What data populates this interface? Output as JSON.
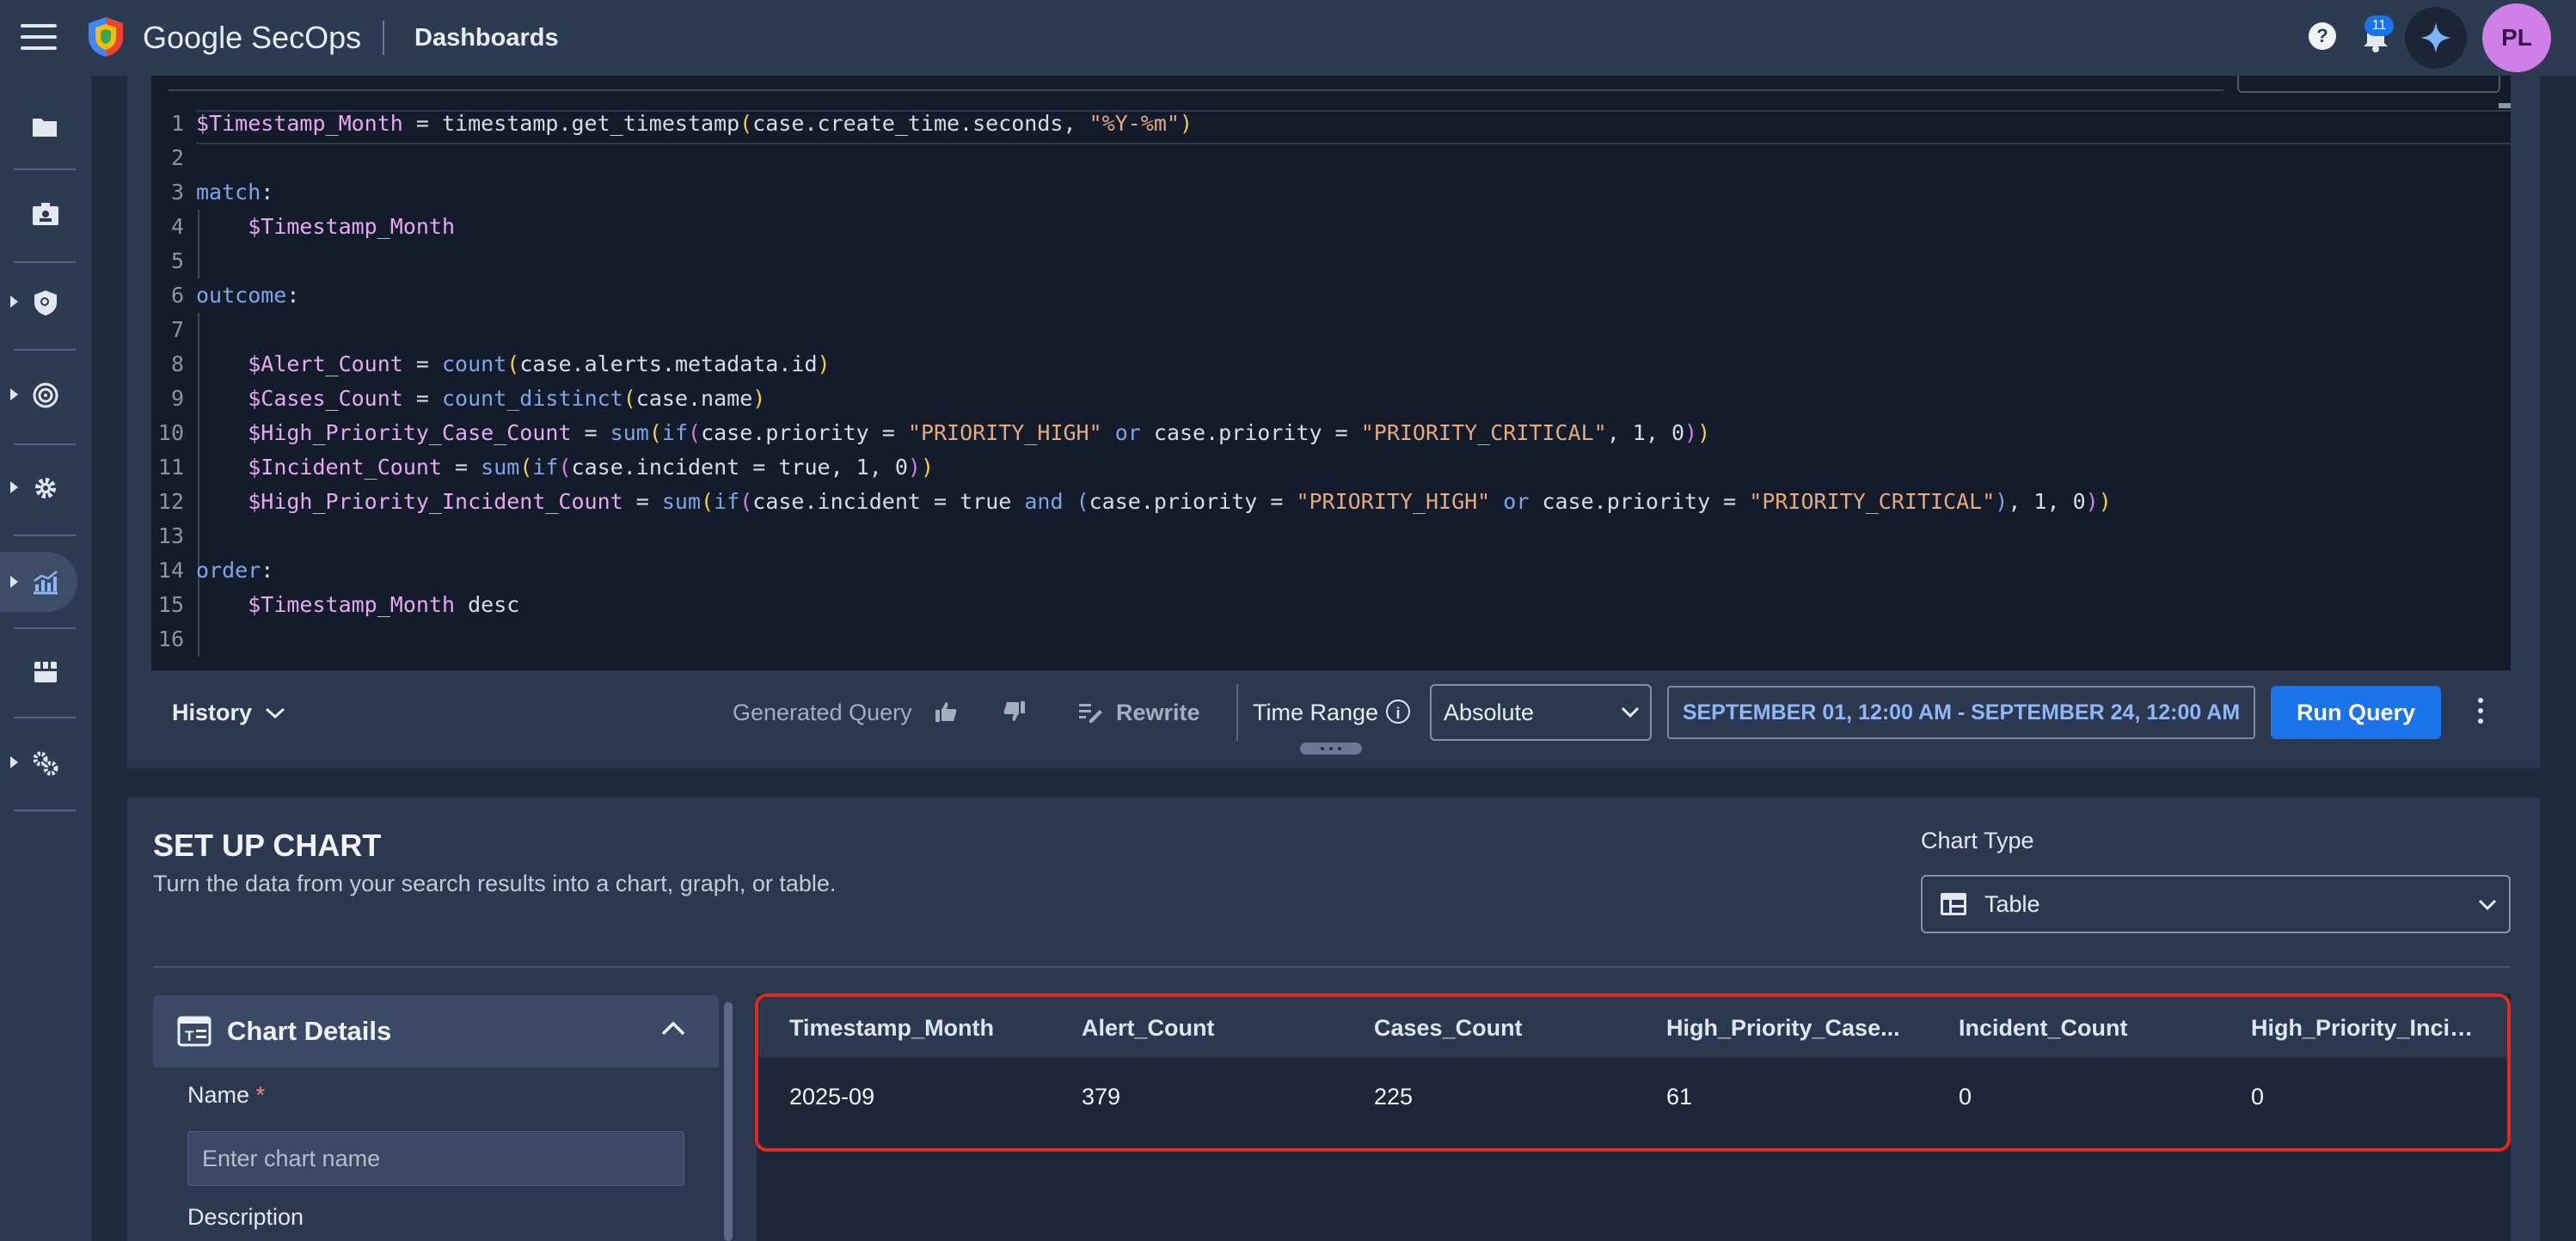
{
  "header": {
    "brand": "Google SecOps",
    "page_title": "Dashboards",
    "notification_count": "11",
    "avatar_initials": "PL",
    "help_glyph": "?"
  },
  "sidebar": {
    "items": [
      {
        "icon": "folder-icon"
      },
      {
        "icon": "cases-icon"
      },
      {
        "icon": "detection-icon",
        "expandable": true
      },
      {
        "icon": "investigation-icon",
        "expandable": true
      },
      {
        "icon": "settings-icon",
        "expandable": true
      },
      {
        "icon": "dashboards-icon",
        "expandable": true,
        "active": true
      },
      {
        "icon": "marketplace-icon"
      },
      {
        "icon": "admin-settings-icon",
        "expandable": true
      }
    ]
  },
  "editor": {
    "line_numbers": [
      "1",
      "2",
      "3",
      "4",
      "5",
      "6",
      "7",
      "8",
      "9",
      "10",
      "11",
      "12",
      "13",
      "14",
      "15",
      "16"
    ],
    "line1": {
      "var": "$Timestamp_Month",
      "op": " = ",
      "fn": "timestamp.get_timestamp",
      "open": "(",
      "arg": "case.create_time.seconds, ",
      "str": "\"%Y-%m\"",
      "close": ")"
    },
    "line3": {
      "kw": "match",
      "colon": ":"
    },
    "line4": {
      "var": "$Timestamp_Month"
    },
    "line6": {
      "kw": "outcome",
      "colon": ":"
    },
    "line8": {
      "var": "$Alert_Count",
      "op": " = ",
      "fn": "count",
      "open": "(",
      "arg": "case.alerts.metadata.id",
      "close": ")"
    },
    "line9": {
      "var": "$Cases_Count",
      "op": " = ",
      "fn": "count_distinct",
      "open": "(",
      "arg": "case.name",
      "close": ")"
    },
    "line10": {
      "var": "$High_Priority_Case_Count",
      "op": " = ",
      "fn1": "sum",
      "open1": "(",
      "fn2": "if",
      "open2": "(",
      "a1": "case.priority = ",
      "s1": "\"PRIORITY_HIGH\"",
      "or": " or ",
      "a2": "case.priority = ",
      "s2": "\"PRIORITY_CRITICAL\"",
      "a3": ", 1, 0",
      "close2": ")",
      "close1": ")"
    },
    "line11": {
      "var": "$Incident_Count",
      "op": " = ",
      "fn1": "sum",
      "open1": "(",
      "fn2": "if",
      "open2": "(",
      "a1": "case.incident = true, 1, 0",
      "close2": ")",
      "close1": ")"
    },
    "line12": {
      "var": "$High_Priority_Incident_Count",
      "op": " = ",
      "fn1": "sum",
      "open1": "(",
      "fn2": "if",
      "open2": "(",
      "a1": "case.incident = true ",
      "and": "and",
      "sp": " ",
      "open3": "(",
      "a2": "case.priority = ",
      "s1": "\"PRIORITY_HIGH\"",
      "or": " or ",
      "a3": "case.priority = ",
      "s2": "\"PRIORITY_CRITICAL\"",
      "close3": ")",
      "a4": ", 1, 0",
      "close2": ")",
      "close1": ")"
    },
    "line14": {
      "kw": "order",
      "colon": ":"
    },
    "line15": {
      "var": "$Timestamp_Month",
      "rest": " desc"
    }
  },
  "toolbar": {
    "history_label": "History",
    "generated_query_label": "Generated Query",
    "rewrite_label": "Rewrite",
    "time_range_label": "Time Range",
    "time_mode": "Absolute",
    "date_range": "SEPTEMBER 01, 12:00 AM - SEPTEMBER 24, 12:00 AM",
    "run_label": "Run Query"
  },
  "setup": {
    "title": "SET UP CHART",
    "subtitle": "Turn the data from your search results into a chart, graph, or table.",
    "chart_type_label": "Chart Type",
    "chart_type_value": "Table"
  },
  "details": {
    "title": "Chart Details",
    "name_label": "Name",
    "required_mark": "*",
    "name_placeholder": "Enter chart name",
    "name_value": "",
    "description_label": "Description"
  },
  "results": {
    "columns": [
      "Timestamp_Month",
      "Alert_Count",
      "Cases_Count",
      "High_Priority_Case...",
      "Incident_Count",
      "High_Priority_Incid..."
    ],
    "rows": [
      [
        "2025-09",
        "379",
        "225",
        "61",
        "0",
        "0"
      ]
    ]
  },
  "colors": {
    "accent": "#1a73e8",
    "highlight_border": "#e02a1f",
    "avatar": "#d17fe8"
  }
}
